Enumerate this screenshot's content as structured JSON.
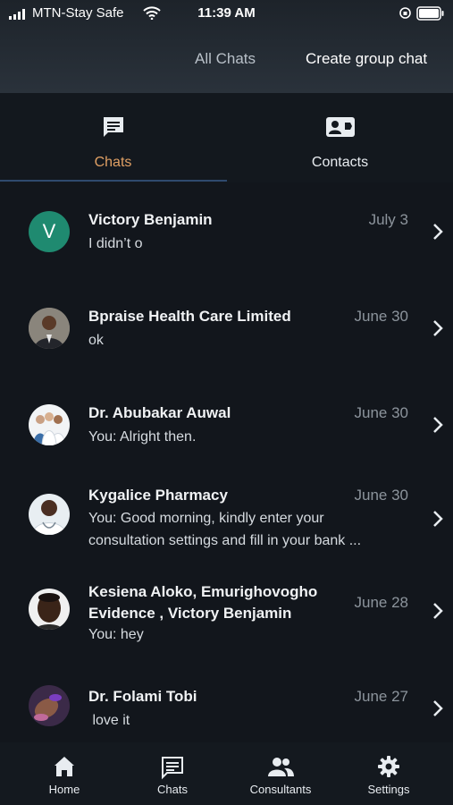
{
  "status_bar": {
    "carrier": "MTN-Stay Safe",
    "time": "11:39 AM"
  },
  "header": {
    "all_chats": "All Chats",
    "create_group_chat": "Create group chat"
  },
  "tabs": [
    {
      "label": "Chats"
    },
    {
      "label": "Contacts"
    }
  ],
  "chats": [
    {
      "name": "Victory Benjamin",
      "date": "July 3",
      "preview": "I didn’t o",
      "avatar_letter": "V"
    },
    {
      "name": "Bpraise Health Care Limited",
      "date": "June 30",
      "preview": "ok"
    },
    {
      "name": "Dr. Abubakar Auwal",
      "date": "June 30",
      "preview": "You: Alright then."
    },
    {
      "name": "Kygalice Pharmacy",
      "date": "June 30",
      "preview_line1": "You: Good morning, kindly enter your",
      "preview_line2": "consultation settings and fill in your bank ..."
    },
    {
      "name_line1": "Kesiena Aloko, Emurighovogho",
      "name_line2": "Evidence , Victory Benjamin",
      "date": "June 28",
      "preview": "You: hey"
    },
    {
      "name": "Dr. Folami Tobi",
      "date": "June 27",
      "preview": " love it"
    }
  ],
  "bottom_nav": [
    {
      "label": "Home",
      "icon": "home-icon"
    },
    {
      "label": "Chats",
      "icon": "chat-icon"
    },
    {
      "label": "Consultants",
      "icon": "people-icon"
    },
    {
      "label": "Settings",
      "icon": "gear-icon"
    }
  ],
  "colors": {
    "active_tab": "#e0a064",
    "avatar_green": "#1f8a70",
    "background": "#12161c"
  }
}
